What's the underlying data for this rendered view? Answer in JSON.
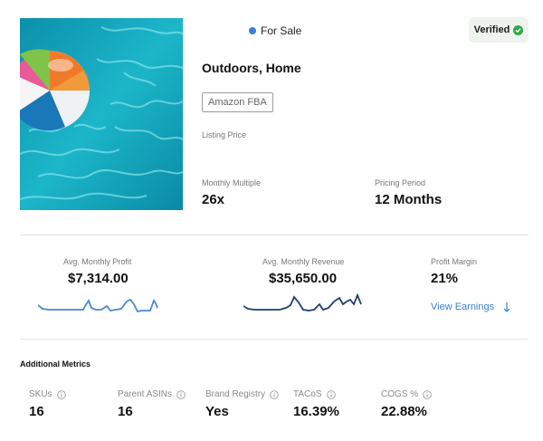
{
  "listing": {
    "status": "For Sale",
    "status_color": "#3b7dd8",
    "verified_label": "Verified",
    "verified_color": "#2ea84a",
    "category": "Outdoors, Home",
    "badge": "Amazon FBA",
    "listing_price_label": "Listing Price",
    "monthly_multiple_label": "Monthly Multiple",
    "monthly_multiple_value": "26x",
    "pricing_period_label": "Pricing Period",
    "pricing_period_value": "12 Months"
  },
  "metrics": {
    "profit_label": "Avg. Monthly Profit",
    "profit_value": "$7,314.00",
    "revenue_label": "Avg. Monthly Revenue",
    "revenue_value": "$35,650.00",
    "margin_label": "Profit Margin",
    "margin_value": "21%",
    "view_earnings": "View Earnings"
  },
  "additional": {
    "title": "Additional Metrics",
    "items": [
      {
        "label": "SKUs",
        "value": "16"
      },
      {
        "label": "Parent ASINs",
        "value": "16"
      },
      {
        "label": "Brand Registry",
        "value": "Yes"
      },
      {
        "label": "TACoS",
        "value": "16.39%"
      },
      {
        "label": "COGS %",
        "value": "22.88%"
      }
    ]
  },
  "icons": {
    "status": "dot-icon",
    "verified": "check-circle-icon",
    "earnings": "arrow-down-icon",
    "metric_info": "info-icon"
  }
}
